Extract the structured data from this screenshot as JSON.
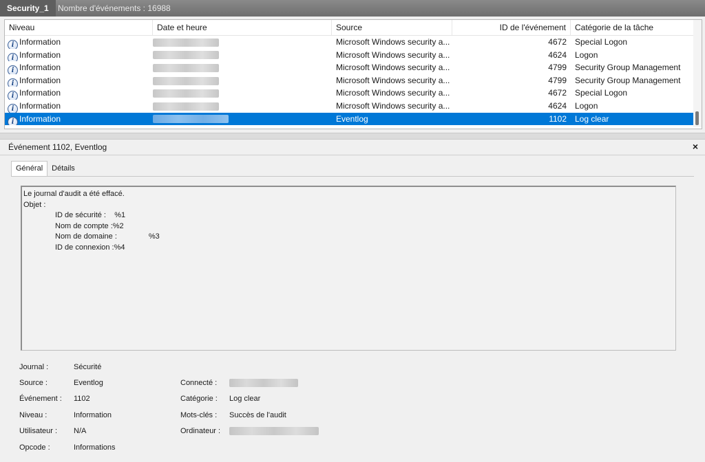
{
  "header": {
    "log_name": "Security_1",
    "events_count": "Nombre d'événements : 16988"
  },
  "table": {
    "columns": [
      "Niveau",
      "Date et heure",
      "Source",
      "ID de l'événement",
      "Catégorie de la tâche"
    ],
    "rows": [
      {
        "level": "Information",
        "date": "",
        "source": "Microsoft Windows security a...",
        "id": "4672",
        "category": "Special Logon"
      },
      {
        "level": "Information",
        "date": "",
        "source": "Microsoft Windows security a...",
        "id": "4624",
        "category": "Logon"
      },
      {
        "level": "Information",
        "date": "",
        "source": "Microsoft Windows security a...",
        "id": "4799",
        "category": "Security Group Management"
      },
      {
        "level": "Information",
        "date": "",
        "source": "Microsoft Windows security a...",
        "id": "4799",
        "category": "Security Group Management"
      },
      {
        "level": "Information",
        "date": "",
        "source": "Microsoft Windows security a...",
        "id": "4672",
        "category": "Special Logon"
      },
      {
        "level": "Information",
        "date": "",
        "source": "Microsoft Windows security a...",
        "id": "4624",
        "category": "Logon"
      },
      {
        "level": "Information",
        "date": "",
        "source": "Eventlog",
        "id": "1102",
        "category": "Log clear"
      }
    ],
    "selected_row": 6
  },
  "detail": {
    "title": "Événement 1102, Eventlog",
    "close": "×",
    "tabs": [
      "Général",
      "Détails"
    ],
    "description": {
      "line1": "Le journal d'audit a été effacé.",
      "line2": "Objet :",
      "fields": [
        {
          "label": "ID de sécurité :",
          "value": "%1"
        },
        {
          "label": "Nom de compte :",
          "value": "%2"
        },
        {
          "label": "Nom de domaine :",
          "value": "%3"
        },
        {
          "label": "ID de connexion :",
          "value": "%4"
        }
      ]
    },
    "props_left": [
      {
        "label": "Journal :",
        "value": "Sécurité"
      },
      {
        "label": "Source :",
        "value": "Eventlog"
      },
      {
        "label": "Événement :",
        "value": "1102"
      },
      {
        "label": "Niveau :",
        "value": "Information"
      },
      {
        "label": "Utilisateur :",
        "value": "N/A"
      },
      {
        "label": "Opcode :",
        "value": "Informations"
      }
    ],
    "props_right": [
      {
        "label": "Connecté :",
        "value": ""
      },
      {
        "label": "Catégorie :",
        "value": "Log clear"
      },
      {
        "label": "Mots-clés :",
        "value": "Succès de l'audit"
      },
      {
        "label": "Ordinateur :",
        "value": ""
      }
    ]
  },
  "colors": {
    "selection": "#0078d7",
    "header_bg": "#6e6e6e"
  }
}
